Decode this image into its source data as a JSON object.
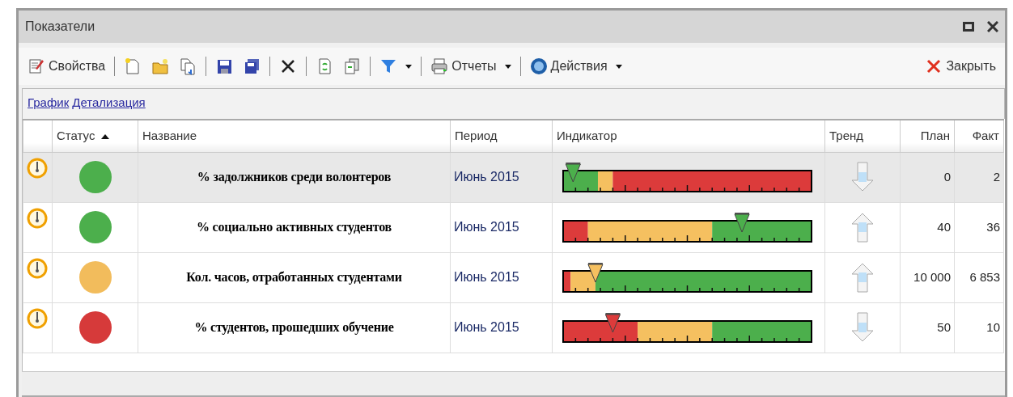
{
  "window": {
    "title": "Показатели"
  },
  "toolbar": {
    "properties": "Свойства",
    "reports": "Отчеты",
    "actions": "Действия",
    "close": "Закрыть"
  },
  "links": [
    "График",
    "Детализация"
  ],
  "table": {
    "columns": [
      {
        "label": "Статус",
        "sorted": true
      },
      {
        "label": "Название",
        "sorted": false
      },
      {
        "label": "Период",
        "sorted": false
      },
      {
        "label": "Индикатор",
        "sorted": false
      },
      {
        "label": "Тренд",
        "sorted": false
      },
      {
        "label": "План",
        "sorted": false
      },
      {
        "label": "Факт",
        "sorted": false
      }
    ],
    "rows": [
      {
        "selected": true,
        "status": {
          "color": "#4caf4c"
        },
        "name": "% задолжников среди волонтеров",
        "period": "Июнь 2015",
        "indicator": {
          "zones": [
            {
              "color": "#4caf4c"
            },
            {
              "color": "#f5c060"
            },
            {
              "color": "#dc3b3b"
            }
          ]
        },
        "trend": {
          "kind": "down"
        },
        "plan": "0",
        "fact": "2"
      },
      {
        "selected": false,
        "status": {
          "color": "#4caf4c"
        },
        "name": "% социально активных студентов",
        "period": "Июнь 2015",
        "indicator": {
          "zones": [
            {
              "color": "#dc3b3b"
            },
            {
              "color": "#f5c060"
            },
            {
              "color": "#4caf4c"
            }
          ]
        },
        "trend": {
          "kind": "up"
        },
        "plan": "40",
        "fact": "36"
      },
      {
        "selected": false,
        "status": {
          "color": "#f2bc5c"
        },
        "name": "Кол. часов, отработанных студентами",
        "period": "Июнь 2015",
        "indicator": {
          "zones": [
            {
              "color": "#dc3b3b"
            },
            {
              "color": "#f5c060"
            },
            {
              "color": "#4caf4c"
            }
          ]
        },
        "trend": {
          "kind": "up"
        },
        "plan": "10 000",
        "fact": "6 853"
      },
      {
        "selected": false,
        "status": {
          "color": "#d63a3a"
        },
        "name": "% студентов, прошедших обучение",
        "period": "Июнь 2015",
        "indicator": {
          "zones": [
            {
              "color": "#dc3b3b"
            },
            {
              "color": "#f5c060"
            },
            {
              "color": "#4caf4c"
            }
          ]
        },
        "trend": {
          "kind": "down"
        },
        "plan": "50",
        "fact": "10"
      }
    ]
  }
}
